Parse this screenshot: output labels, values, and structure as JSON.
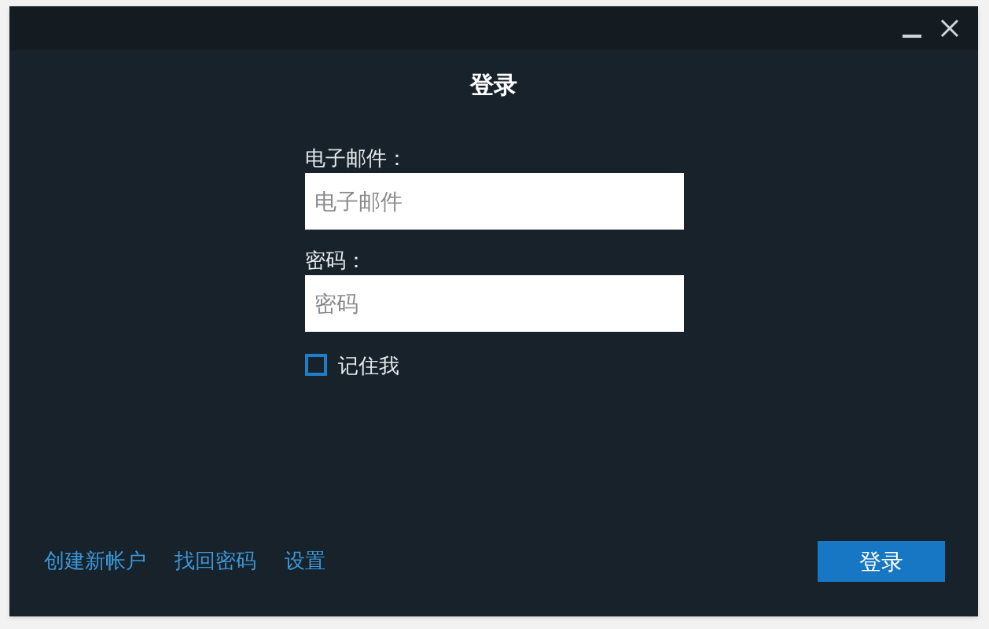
{
  "dialog": {
    "title": "登录"
  },
  "email": {
    "label": "电子邮件：",
    "placeholder": "电子邮件"
  },
  "password": {
    "label": "密码：",
    "placeholder": "密码"
  },
  "remember": {
    "label": "记住我",
    "checked": false
  },
  "links": [
    "创建新帐户",
    "找回密码",
    "设置"
  ],
  "submit": "登录"
}
